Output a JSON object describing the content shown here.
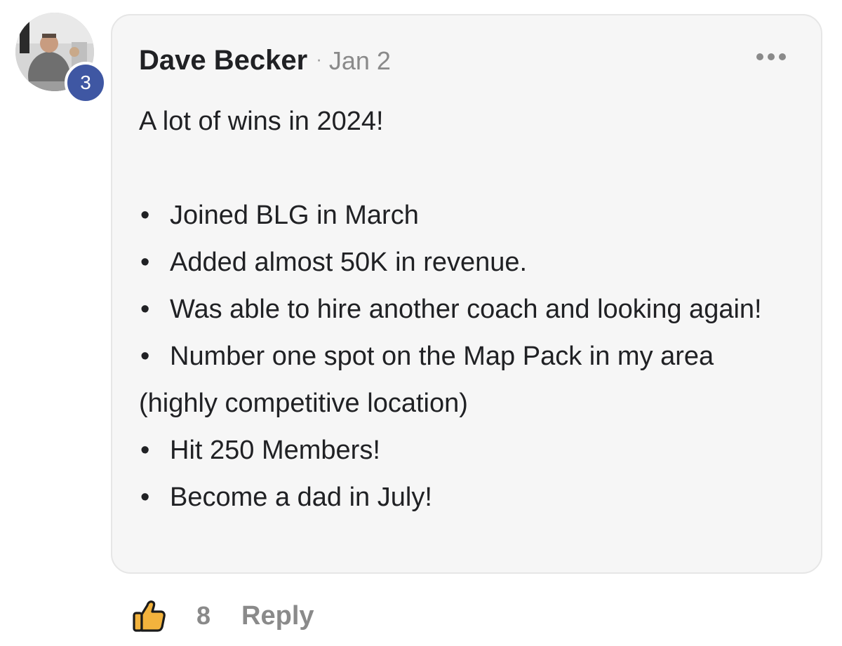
{
  "comment": {
    "author": "Dave Becker",
    "separator": "·",
    "date": "Jan 2",
    "level": "3",
    "lines": {
      "intro": "A lot of wins in 2024!",
      "item1": "Joined BLG in March",
      "item2": "Added almost 50K in revenue.",
      "item3": "Was able to hire another coach and looking again!",
      "item4": "Number one spot on the Map Pack in my area (highly competitive location)",
      "item5": "Hit 250 Members!",
      "item6": "Become a dad in July!"
    }
  },
  "actions": {
    "like_count": "8",
    "reply_label": "Reply"
  },
  "icons": {
    "more": "more-options-icon",
    "like": "thumbs-up-icon"
  },
  "colors": {
    "badge": "#3f57a3",
    "like_icon_fill": "#f3b33d",
    "bubble_background": "#f6f6f6",
    "muted_text": "#8a8a8a"
  }
}
